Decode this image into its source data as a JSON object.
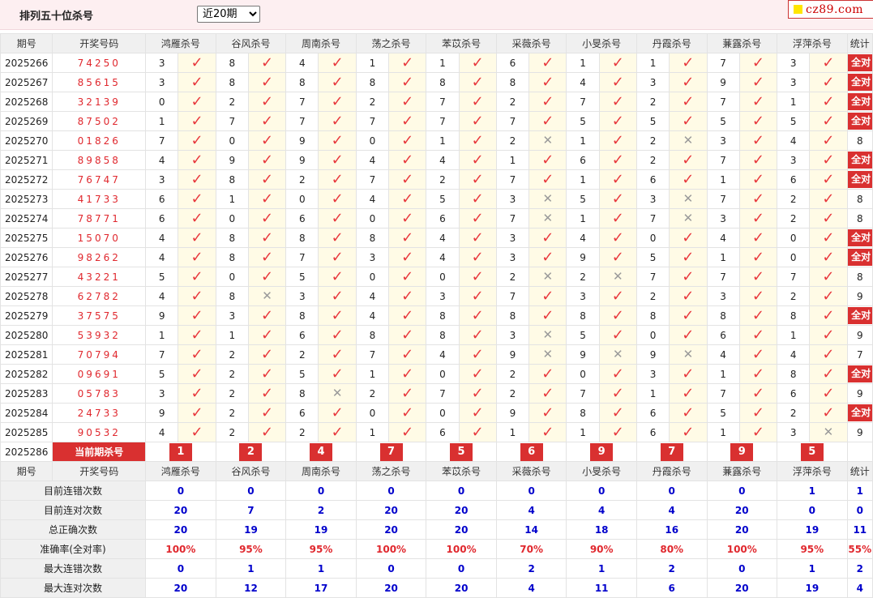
{
  "header": {
    "title": "排列五十位杀号",
    "period_selected": "近20期",
    "period_options": [
      "近20期"
    ],
    "logo": "cz89.com"
  },
  "columns": {
    "issue": "期号",
    "draw": "开奖号码",
    "experts": [
      "鸿雁杀号",
      "谷风杀号",
      "周南杀号",
      "荡之杀号",
      "苯苡杀号",
      "采薇杀号",
      "小旻杀号",
      "丹霞杀号",
      "蒹露杀号",
      "浮萍杀号"
    ],
    "stat": "统计"
  },
  "all_correct_label": "全对",
  "rows": [
    {
      "issue": "2025266",
      "draw": "74250",
      "kills": [
        3,
        8,
        4,
        1,
        1,
        6,
        1,
        1,
        7,
        3
      ],
      "ok": [
        1,
        1,
        1,
        1,
        1,
        1,
        1,
        1,
        1,
        1
      ],
      "stat": "全对"
    },
    {
      "issue": "2025267",
      "draw": "85615",
      "kills": [
        3,
        8,
        8,
        8,
        8,
        8,
        4,
        3,
        9,
        3
      ],
      "ok": [
        1,
        1,
        1,
        1,
        1,
        1,
        1,
        1,
        1,
        1
      ],
      "stat": "全对"
    },
    {
      "issue": "2025268",
      "draw": "32139",
      "kills": [
        0,
        2,
        7,
        2,
        7,
        2,
        7,
        2,
        7,
        1
      ],
      "ok": [
        1,
        1,
        1,
        1,
        1,
        1,
        1,
        1,
        1,
        1
      ],
      "stat": "全对"
    },
    {
      "issue": "2025269",
      "draw": "87502",
      "kills": [
        1,
        7,
        7,
        7,
        7,
        7,
        5,
        5,
        5,
        5
      ],
      "ok": [
        1,
        1,
        1,
        1,
        1,
        1,
        1,
        1,
        1,
        1
      ],
      "stat": "全对"
    },
    {
      "issue": "2025270",
      "draw": "01826",
      "kills": [
        7,
        0,
        9,
        0,
        1,
        2,
        1,
        2,
        3,
        4
      ],
      "ok": [
        1,
        1,
        1,
        1,
        1,
        0,
        1,
        0,
        1,
        1
      ],
      "stat": "8"
    },
    {
      "issue": "2025271",
      "draw": "89858",
      "kills": [
        4,
        9,
        9,
        4,
        4,
        1,
        6,
        2,
        7,
        3
      ],
      "ok": [
        1,
        1,
        1,
        1,
        1,
        1,
        1,
        1,
        1,
        1
      ],
      "stat": "全对"
    },
    {
      "issue": "2025272",
      "draw": "76747",
      "kills": [
        3,
        8,
        2,
        7,
        2,
        7,
        1,
        6,
        1,
        6
      ],
      "ok": [
        1,
        1,
        1,
        1,
        1,
        1,
        1,
        1,
        1,
        1
      ],
      "stat": "全对"
    },
    {
      "issue": "2025273",
      "draw": "41733",
      "kills": [
        6,
        1,
        0,
        4,
        5,
        3,
        5,
        3,
        7,
        2
      ],
      "ok": [
        1,
        1,
        1,
        1,
        1,
        0,
        1,
        0,
        1,
        1
      ],
      "stat": "8"
    },
    {
      "issue": "2025274",
      "draw": "78771",
      "kills": [
        6,
        0,
        6,
        0,
        6,
        7,
        1,
        7,
        3,
        2
      ],
      "ok": [
        1,
        1,
        1,
        1,
        1,
        0,
        1,
        0,
        1,
        1
      ],
      "stat": "8"
    },
    {
      "issue": "2025275",
      "draw": "15070",
      "kills": [
        4,
        8,
        8,
        8,
        4,
        3,
        4,
        0,
        4,
        0
      ],
      "ok": [
        1,
        1,
        1,
        1,
        1,
        1,
        1,
        1,
        1,
        1
      ],
      "stat": "全对"
    },
    {
      "issue": "2025276",
      "draw": "98262",
      "kills": [
        4,
        8,
        7,
        3,
        4,
        3,
        9,
        5,
        1,
        0
      ],
      "ok": [
        1,
        1,
        1,
        1,
        1,
        1,
        1,
        1,
        1,
        1
      ],
      "stat": "全对"
    },
    {
      "issue": "2025277",
      "draw": "43221",
      "kills": [
        5,
        0,
        5,
        0,
        0,
        2,
        2,
        7,
        7,
        7
      ],
      "ok": [
        1,
        1,
        1,
        1,
        1,
        0,
        0,
        1,
        1,
        1
      ],
      "stat": "8"
    },
    {
      "issue": "2025278",
      "draw": "62782",
      "kills": [
        4,
        8,
        3,
        4,
        3,
        7,
        3,
        2,
        3,
        2
      ],
      "ok": [
        1,
        0,
        1,
        1,
        1,
        1,
        1,
        1,
        1,
        1
      ],
      "stat": "9"
    },
    {
      "issue": "2025279",
      "draw": "37575",
      "kills": [
        9,
        3,
        8,
        4,
        8,
        8,
        8,
        8,
        8,
        8
      ],
      "ok": [
        1,
        1,
        1,
        1,
        1,
        1,
        1,
        1,
        1,
        1
      ],
      "stat": "全对"
    },
    {
      "issue": "2025280",
      "draw": "53932",
      "kills": [
        1,
        1,
        6,
        8,
        8,
        3,
        5,
        0,
        6,
        1
      ],
      "ok": [
        1,
        1,
        1,
        1,
        1,
        0,
        1,
        1,
        1,
        1
      ],
      "stat": "9"
    },
    {
      "issue": "2025281",
      "draw": "70794",
      "kills": [
        7,
        2,
        2,
        7,
        4,
        9,
        9,
        9,
        4,
        4
      ],
      "ok": [
        1,
        1,
        1,
        1,
        1,
        0,
        0,
        0,
        1,
        1
      ],
      "stat": "7"
    },
    {
      "issue": "2025282",
      "draw": "09691",
      "kills": [
        5,
        2,
        5,
        1,
        0,
        2,
        0,
        3,
        1,
        8
      ],
      "ok": [
        1,
        1,
        1,
        1,
        1,
        1,
        1,
        1,
        1,
        1
      ],
      "stat": "全对"
    },
    {
      "issue": "2025283",
      "draw": "05783",
      "kills": [
        3,
        2,
        8,
        2,
        7,
        2,
        7,
        1,
        7,
        6
      ],
      "ok": [
        1,
        1,
        0,
        1,
        1,
        1,
        1,
        1,
        1,
        1
      ],
      "stat": "9"
    },
    {
      "issue": "2025284",
      "draw": "24733",
      "kills": [
        9,
        2,
        6,
        0,
        0,
        9,
        8,
        6,
        5,
        2
      ],
      "ok": [
        1,
        1,
        1,
        1,
        1,
        1,
        1,
        1,
        1,
        1
      ],
      "stat": "全对"
    },
    {
      "issue": "2025285",
      "draw": "90532",
      "kills": [
        4,
        2,
        2,
        1,
        6,
        1,
        1,
        6,
        1,
        3
      ],
      "ok": [
        1,
        1,
        1,
        1,
        1,
        1,
        1,
        1,
        1,
        0
      ],
      "stat": "9"
    }
  ],
  "current": {
    "issue": "2025286",
    "label": "当前期杀号",
    "kills": [
      1,
      2,
      4,
      7,
      5,
      6,
      9,
      7,
      9,
      5
    ]
  },
  "summary": [
    {
      "label": "目前连错次数",
      "values": [
        "0",
        "0",
        "0",
        "0",
        "0",
        "0",
        "0",
        "0",
        "0",
        "1",
        "1"
      ]
    },
    {
      "label": "目前连对次数",
      "values": [
        "20",
        "7",
        "2",
        "20",
        "20",
        "4",
        "4",
        "4",
        "20",
        "0",
        "0"
      ]
    },
    {
      "label": "总正确次数",
      "values": [
        "20",
        "19",
        "19",
        "20",
        "20",
        "14",
        "18",
        "16",
        "20",
        "19",
        "11"
      ]
    },
    {
      "label": "准确率(全对率)",
      "values": [
        "100%",
        "95%",
        "95%",
        "100%",
        "100%",
        "70%",
        "90%",
        "80%",
        "100%",
        "95%",
        "55%"
      ],
      "pct": true
    },
    {
      "label": "最大连错次数",
      "values": [
        "0",
        "1",
        "1",
        "0",
        "0",
        "2",
        "1",
        "2",
        "0",
        "1",
        "2"
      ]
    },
    {
      "label": "最大连对次数",
      "values": [
        "20",
        "12",
        "17",
        "20",
        "20",
        "4",
        "11",
        "6",
        "20",
        "19",
        "4"
      ]
    }
  ]
}
